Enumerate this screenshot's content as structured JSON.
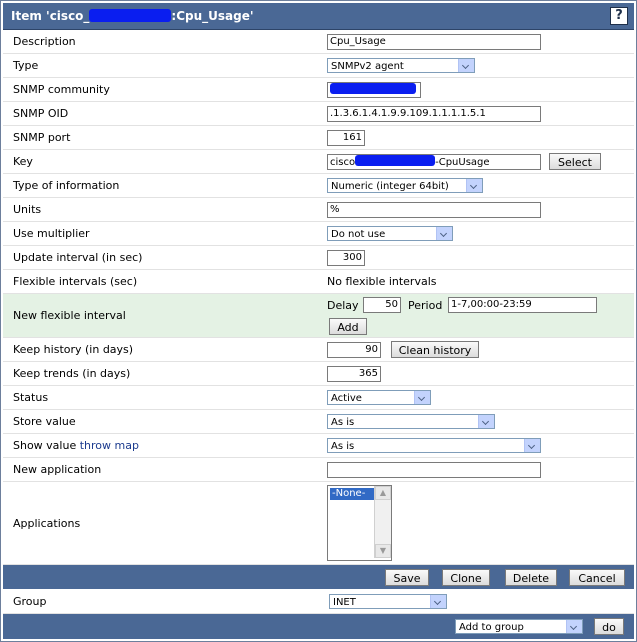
{
  "header": {
    "title_prefix": "Item 'cisco_",
    "title_suffix": ":Cpu_Usage'",
    "help_label": "?"
  },
  "fields": {
    "description": {
      "label": "Description",
      "value": "Cpu_Usage"
    },
    "type": {
      "label": "Type",
      "value": "SNMPv2 agent"
    },
    "snmp_community": {
      "label": "SNMP community"
    },
    "snmp_oid": {
      "label": "SNMP OID",
      "value": ".1.3.6.1.4.1.9.9.109.1.1.1.1.5.1"
    },
    "snmp_port": {
      "label": "SNMP port",
      "value": "161"
    },
    "key": {
      "label": "Key",
      "value_prefix": "cisco",
      "value_suffix": "-CpuUsage",
      "select_button": "Select"
    },
    "type_of_information": {
      "label": "Type of information",
      "value": "Numeric (integer 64bit)"
    },
    "units": {
      "label": "Units",
      "value": "%"
    },
    "use_multiplier": {
      "label": "Use multiplier",
      "value": "Do not use"
    },
    "update_interval": {
      "label": "Update interval (in sec)",
      "value": "300"
    },
    "flexible_intervals": {
      "label": "Flexible intervals (sec)",
      "value": "No flexible intervals"
    },
    "new_flexible_interval": {
      "label": "New flexible interval",
      "delay_label": "Delay",
      "delay_value": "50",
      "period_label": "Period",
      "period_value": "1-7,00:00-23:59",
      "add_button": "Add"
    },
    "keep_history": {
      "label": "Keep history (in days)",
      "value": "90",
      "button": "Clean history"
    },
    "keep_trends": {
      "label": "Keep trends (in days)",
      "value": "365"
    },
    "status": {
      "label": "Status",
      "value": "Active"
    },
    "store_value": {
      "label": "Store value",
      "value": "As is"
    },
    "show_value": {
      "label": "Show value",
      "link": "throw map",
      "value": "As is"
    },
    "new_application": {
      "label": "New application",
      "value": ""
    },
    "applications": {
      "label": "Applications",
      "options": [
        "-None-"
      ]
    }
  },
  "actions": {
    "save": "Save",
    "clone": "Clone",
    "delete": "Delete",
    "cancel": "Cancel"
  },
  "group": {
    "label": "Group",
    "value": "INET"
  },
  "footer": {
    "add_to_group": "Add to group",
    "do_button": "do"
  }
}
